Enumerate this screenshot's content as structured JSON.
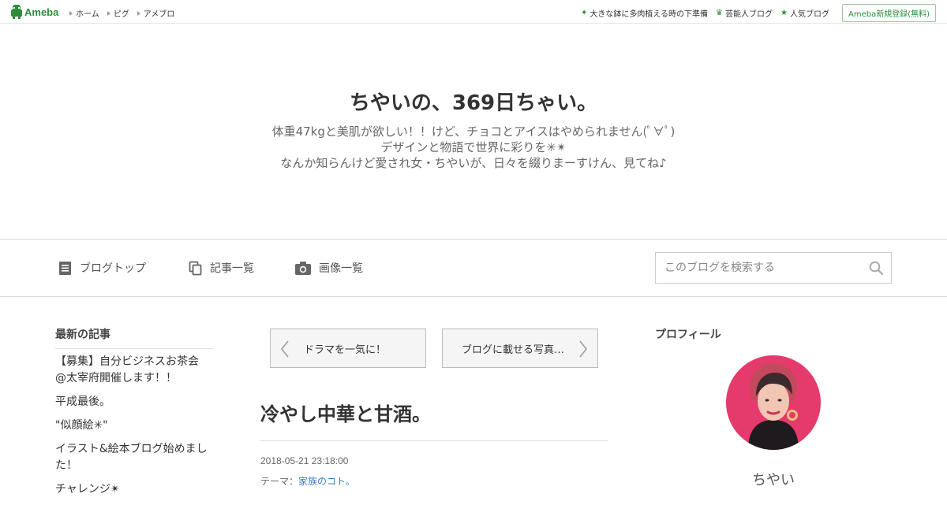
{
  "topbar": {
    "logo_text": "Ameba",
    "nav": [
      "ホーム",
      "ピグ",
      "アメブロ"
    ],
    "right_links": [
      {
        "icon": "sprout-icon",
        "label": "大きな鉢に多肉植える時の下準備"
      },
      {
        "icon": "crown-icon",
        "label": "芸能人ブログ"
      },
      {
        "icon": "star-icon",
        "label": "人気ブログ"
      }
    ],
    "register_label": "Ameba新規登録(無料)"
  },
  "header": {
    "title": "ちやいの、369日ちゃい。",
    "description": [
      "体重47kgと美肌が欲しい！！けど、チョコとアイスはやめられません(ﾟ∀ﾟ)",
      "デザインと物語で世界に彩りを✳︎✴︎",
      "なんか知らんけど愛され女・ちやいが、日々を綴りまーすけん、見てね♪"
    ]
  },
  "navbar": {
    "items": [
      {
        "icon": "document-icon",
        "label": "ブログトップ"
      },
      {
        "icon": "copy-icon",
        "label": "記事一覧"
      },
      {
        "icon": "camera-icon",
        "label": "画像一覧"
      }
    ],
    "search_placeholder": "このブログを検索する"
  },
  "sidebar_left": {
    "heading": "最新の記事",
    "items": [
      "【募集】自分ビジネスお茶会 @太宰府開催します！！",
      "平成最後。",
      "\"似顔絵✳︎\"",
      "イラスト&絵本ブログ始めました！",
      "チャレンジ✴︎"
    ]
  },
  "main": {
    "prev_label": "ドラマを一気に！",
    "next_label": "ブログに載せる写真…",
    "entry_title": "冷やし中華と甘酒。",
    "entry_date": "2018-05-21 23:18:00",
    "theme_label": "テーマ：",
    "theme_link": "家族のコト。"
  },
  "sidebar_right": {
    "heading": "プロフィール",
    "profile_name": "ちやい"
  },
  "colors": {
    "accent": "#2d8c3c",
    "link": "#3a7cc4",
    "avatar_bg": "#e53a6c"
  }
}
